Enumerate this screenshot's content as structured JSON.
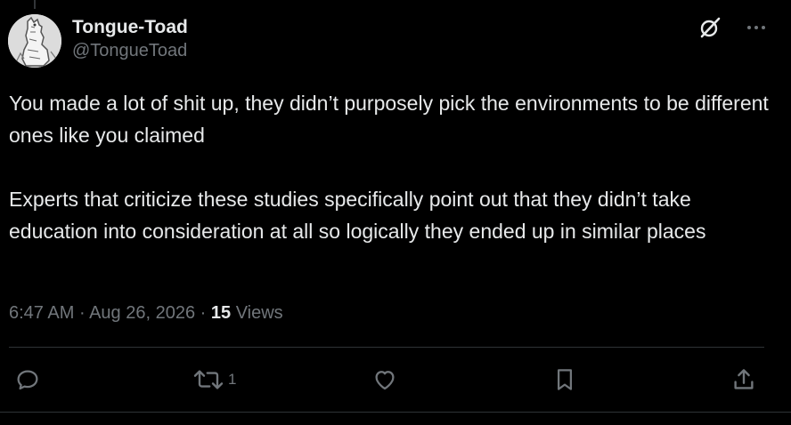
{
  "author": {
    "display_name": "Tongue-Toad",
    "handle": "@TongueToad"
  },
  "tweet": {
    "paragraphs": [
      "You made a lot of shit up, they didn’t purposely pick the environments to be different ones like you claimed",
      "Experts that criticize these studies specifically point out that they didn’t take education into consideration at all so logically they ended up in similar places"
    ],
    "time": "6:47 AM",
    "date": "Aug 26, 2026",
    "views_count": "15",
    "views_label": "Views",
    "separator": "·"
  },
  "actions": {
    "reply_count": "",
    "retweet_count": "1",
    "like_count": "",
    "icons": [
      "reply-icon",
      "retweet-icon",
      "like-icon",
      "bookmark-icon",
      "share-icon"
    ]
  },
  "top_icons": [
    "grok-icon",
    "more-icon"
  ],
  "colors": {
    "background": "#000000",
    "text_primary": "#e7e9ea",
    "text_secondary": "#71767b",
    "divider": "#2f3336"
  }
}
